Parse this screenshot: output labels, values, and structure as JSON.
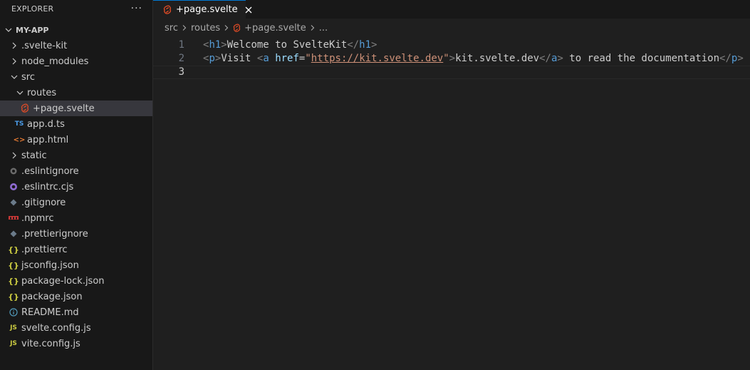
{
  "explorer": {
    "title": "EXPLORER",
    "more_icon": "more-actions-icon",
    "project": "MY-APP",
    "items": [
      {
        "label": ".svelte-kit",
        "kind": "folder",
        "expanded": false
      },
      {
        "label": "node_modules",
        "kind": "folder",
        "expanded": false
      },
      {
        "label": "src",
        "kind": "folder",
        "expanded": true
      },
      {
        "label": "routes",
        "kind": "folder",
        "expanded": true
      },
      {
        "label": "+page.svelte",
        "kind": "svelte-file",
        "selected": true
      },
      {
        "label": "app.d.ts",
        "kind": "ts-file",
        "icon_text": "TS"
      },
      {
        "label": "app.html",
        "kind": "html-file",
        "icon_text": "<>"
      },
      {
        "label": "static",
        "kind": "folder",
        "expanded": false
      },
      {
        "label": ".eslintignore",
        "kind": "eslintignore-file"
      },
      {
        "label": ".eslintrc.cjs",
        "kind": "eslint-file"
      },
      {
        "label": ".gitignore",
        "kind": "git-file"
      },
      {
        "label": ".npmrc",
        "kind": "npm-file"
      },
      {
        "label": ".prettierignore",
        "kind": "prettierignore-file"
      },
      {
        "label": ".prettierrc",
        "kind": "json-file",
        "icon_text": "{}"
      },
      {
        "label": "jsconfig.json",
        "kind": "json-file",
        "icon_text": "{}"
      },
      {
        "label": "package-lock.json",
        "kind": "json-file",
        "icon_text": "{}"
      },
      {
        "label": "package.json",
        "kind": "json-file",
        "icon_text": "{}"
      },
      {
        "label": "README.md",
        "kind": "info-file"
      },
      {
        "label": "svelte.config.js",
        "kind": "js-file",
        "icon_text": "JS"
      },
      {
        "label": "vite.config.js",
        "kind": "js-file",
        "icon_text": "JS"
      }
    ]
  },
  "editor": {
    "tab": {
      "label": "+page.svelte",
      "close_icon": "close-icon"
    },
    "breadcrumbs": [
      "src",
      "routes",
      "+page.svelte",
      "..."
    ],
    "line_numbers": [
      "1",
      "2",
      "3"
    ],
    "code": {
      "line1": {
        "open_lt": "<",
        "open_tag": "h1",
        "open_gt": ">",
        "text": "Welcome to SvelteKit",
        "close_lt": "</",
        "close_tag": "h1",
        "close_gt": ">"
      },
      "line2": {
        "p_lt": "<",
        "p_tag": "p",
        "p_gt": ">",
        "visit": "Visit ",
        "a_lt": "<",
        "a_tag": "a",
        "space": " ",
        "attr": "href",
        "eq": "=",
        "q1": "\"",
        "url": "https://kit.svelte.dev",
        "q2": "\"",
        "a_gt": ">",
        "link_text": "kit.svelte.dev",
        "a_close_lt": "</",
        "a_close_tag": "a",
        "a_close_gt": ">",
        "rest": " to read the documentation",
        "p_close_lt": "</",
        "p_close_tag": "p",
        "p_close_gt": ">"
      }
    }
  },
  "colors": {
    "accent": "#0078d4",
    "svelte": "#e34c26",
    "tag": "#569cd6",
    "attribute": "#9cdcfe",
    "string": "#ce9178",
    "json": "#cbcb41"
  }
}
